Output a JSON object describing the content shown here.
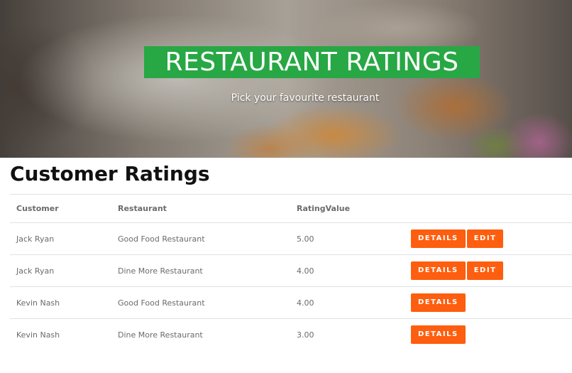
{
  "hero": {
    "title": "RESTAURANT RATINGS",
    "subtitle": "Pick your favourite restaurant"
  },
  "section": {
    "title": "Customer Ratings"
  },
  "table": {
    "headers": [
      "Customer",
      "Restaurant",
      "RatingValue",
      ""
    ],
    "rows": [
      {
        "customer": "Jack Ryan",
        "restaurant": "Good Food Restaurant",
        "rating": "5.00",
        "details_label": "DETAILS",
        "edit_label": "EDIT"
      },
      {
        "customer": "Jack Ryan",
        "restaurant": "Dine More Restaurant",
        "rating": "4.00",
        "details_label": "DETAILS",
        "edit_label": "EDIT"
      },
      {
        "customer": "Kevin Nash",
        "restaurant": "Good Food Restaurant",
        "rating": "4.00",
        "details_label": "DETAILS"
      },
      {
        "customer": "Kevin Nash",
        "restaurant": "Dine More Restaurant",
        "rating": "3.00",
        "details_label": "DETAILS"
      }
    ]
  },
  "colors": {
    "banner_green": "#28a745",
    "button_orange": "#fd5e0f"
  }
}
